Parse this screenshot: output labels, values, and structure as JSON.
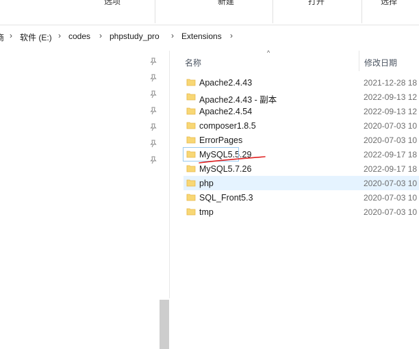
{
  "ribbon": {
    "labels": [
      "选项",
      "新建",
      "打开",
      "选择"
    ]
  },
  "address": {
    "crumbs": [
      "商",
      "软件 (E:)",
      "codes",
      "phpstudy_pro",
      "Extensions"
    ]
  },
  "columns": {
    "name": "名称",
    "date": "修改日期"
  },
  "files": [
    {
      "name": "Apache2.4.43",
      "date": "2021-12-28 18"
    },
    {
      "name": "Apache2.4.43 - 副本",
      "date": "2022-09-13 12"
    },
    {
      "name": "Apache2.4.54",
      "date": "2022-09-13 12"
    },
    {
      "name": "composer1.8.5",
      "date": "2020-07-03 10"
    },
    {
      "name": "ErrorPages",
      "date": "2020-07-03 10"
    },
    {
      "name": "MySQL5.5.29",
      "date": "2022-09-17 18"
    },
    {
      "name": "MySQL5.7.26",
      "date": "2022-09-17 18"
    },
    {
      "name": "php",
      "date": "2020-07-03 10"
    },
    {
      "name": "SQL_Front5.3",
      "date": "2020-07-03 10"
    },
    {
      "name": "tmp",
      "date": "2020-07-03 10"
    }
  ],
  "colors": {
    "folder": "#f8d775",
    "folder_dark": "#e6b84a",
    "hover": "#e5f3ff",
    "annotation": "#e02020"
  },
  "icons": {
    "pin": "pin-icon",
    "folder": "folder-icon",
    "sort": "sort-up-icon",
    "separator": "chevron-right-icon"
  }
}
